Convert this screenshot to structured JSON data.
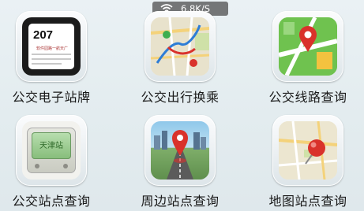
{
  "status_bar": {
    "net_speed": "6.8K/S",
    "wifi_icon": "wifi-icon"
  },
  "tiles": [
    {
      "label": "公交电子站牌",
      "icon": "bus-stop-sign-icon",
      "sign_number": "207",
      "sign_text": "软件园路一航天广"
    },
    {
      "label": "公交出行换乘",
      "icon": "route-map-icon"
    },
    {
      "label": "公交线路查询",
      "icon": "map-pin-route-icon"
    },
    {
      "label": "公交站点查询",
      "icon": "stop-monitor-icon",
      "screen_text": "天津站"
    },
    {
      "label": "周边站点查询",
      "icon": "nearby-location-icon"
    },
    {
      "label": "地图站点查询",
      "icon": "map-pushpin-icon"
    }
  ],
  "colors": {
    "background": "#e3ecef",
    "accent_red": "#d9322b",
    "map_green": "#3fae4f"
  }
}
